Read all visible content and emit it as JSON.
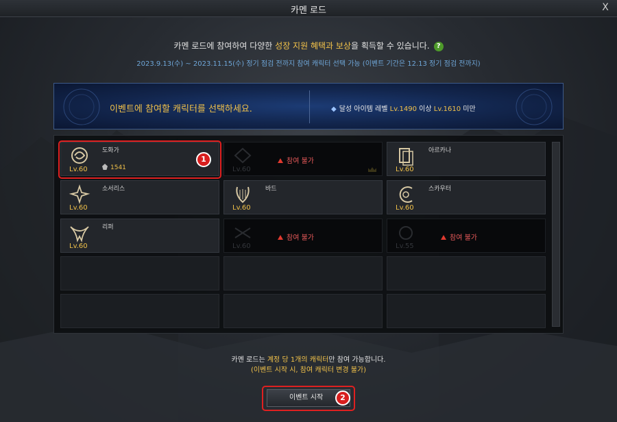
{
  "window": {
    "title": "카멘 로드",
    "close_label": "X"
  },
  "intro": {
    "before": "카멘 로드에 참여하여 다양한 ",
    "highlight": "성장 지원 혜택과 보상",
    "after": "을 획득할 수 있습니다.",
    "help_label": "?",
    "period": "2023.9.13(수) ~ 2023.11.15(수) 정기 점검 전까지 참여 캐릭터 선택 가능 (이벤트 기간은 12.13 정기 점검 전까지)"
  },
  "banner": {
    "main": "이벤트에 참여할 캐릭터를 선택하세요.",
    "cond_prefix": "달성 아이템 레벨 ",
    "cond_min": "Lv.1490",
    "cond_mid": " 이상 ",
    "cond_max": "Lv.1610",
    "cond_suffix": " 미만"
  },
  "characters": [
    {
      "name": "도화가",
      "level": "Lv.60",
      "item_level": "1541",
      "icon": "artist-icon"
    },
    {
      "name": "",
      "level": "Lv.60",
      "status": "참여 불가",
      "icon": "blocked-class-icon"
    },
    {
      "name": "아르카나",
      "level": "Lv.60",
      "icon": "arcana-icon"
    },
    {
      "name": "소서리스",
      "level": "Lv.60",
      "icon": "sorceress-icon"
    },
    {
      "name": "바드",
      "level": "Lv.60",
      "icon": "bard-icon"
    },
    {
      "name": "스카우터",
      "level": "Lv.60",
      "icon": "scouter-icon"
    },
    {
      "name": "리퍼",
      "level": "Lv.60",
      "icon": "reaper-icon"
    },
    {
      "name": "",
      "level": "Lv.60",
      "status": "참여 불가",
      "icon": "blocked-class-icon"
    },
    {
      "name": "",
      "level": "Lv.55",
      "status": "참여 불가",
      "icon": "blocked-class-icon"
    }
  ],
  "annotations": {
    "step1": "1",
    "step2": "2"
  },
  "notice": {
    "before": "카멘 로드는 ",
    "highlight": "계정 당 1개의 캐릭터",
    "after": "만 참여 가능합니다.",
    "line2": "(이벤트 시작 시, 참여 캐릭터 변경 불가)"
  },
  "start_button": {
    "label": "이벤트 시작"
  },
  "colors": {
    "accent": "#f2c24a",
    "warning": "#e85a5a",
    "link_blue": "#6fa7d9",
    "highlight_box": "#e02020"
  }
}
